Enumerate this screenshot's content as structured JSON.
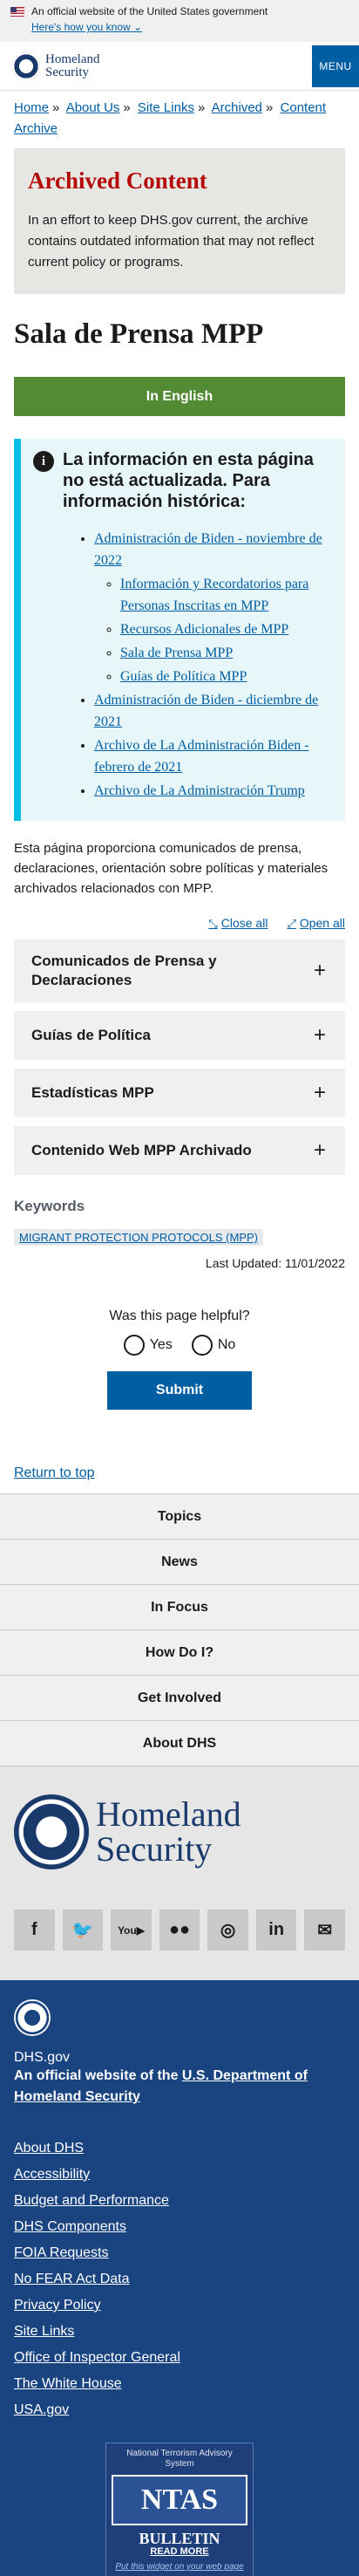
{
  "gov_banner": {
    "text": "An official website of the United States government",
    "link": "Here's how you know"
  },
  "header": {
    "logo_line1": "Homeland",
    "logo_line2": "Security",
    "menu_label": "MENU"
  },
  "breadcrumb": [
    "Home",
    "About Us",
    "Site Links",
    "Archived",
    "Content Archive"
  ],
  "archived": {
    "title": "Archived Content",
    "body": "In an effort to keep DHS.gov current, the archive contains outdated information that may not reflect current policy or programs."
  },
  "page_title": "Sala de Prensa MPP",
  "english_button": "In English",
  "alert": {
    "heading": "La información en esta página no está actualizada. Para información histórica:",
    "items": [
      {
        "label": "Administración de Biden - noviembre de 2022",
        "children": [
          "Información y Recordatorios para Personas Inscritas en MPP",
          "Recursos Adicionales de MPP",
          "Sala de Prensa MPP",
          "Guías de Política MPP"
        ]
      },
      {
        "label": "Administración de Biden - diciembre de 2021"
      },
      {
        "label": "Archivo de La Administración Biden - febrero de 2021"
      },
      {
        "label": "Archivo de La Administración Trump"
      }
    ]
  },
  "intro": "Esta página proporciona comunicados de prensa, declaraciones, orientación sobre políticas y materiales archivados relacionados con MPP.",
  "toggles": {
    "close_all": "Close all",
    "open_all": "Open all"
  },
  "accordion": [
    "Comunicados de Prensa y Declaraciones",
    "Guías de Política",
    "Estadísticas MPP",
    "Contenido Web MPP Archivado"
  ],
  "keywords": {
    "title": "Keywords",
    "tag": "MIGRANT PROTECTION PROTOCOLS (MPP)"
  },
  "last_updated": "Last Updated: 11/01/2022",
  "helpful": {
    "question": "Was this page helpful?",
    "yes": "Yes",
    "no": "No",
    "submit": "Submit"
  },
  "return_to_top": "Return to top",
  "footer_nav": [
    "Topics",
    "News",
    "In Focus",
    "How Do I?",
    "Get Involved",
    "About DHS"
  ],
  "footer_logo": {
    "line1": "Homeland",
    "line2": "Security"
  },
  "socials": [
    "facebook-icon",
    "twitter-icon",
    "youtube-icon",
    "flickr-icon",
    "instagram-icon",
    "linkedin-icon",
    "email-icon"
  ],
  "dark_footer": {
    "site": "DHS.gov",
    "official_prefix": "An official website of the ",
    "official_link": "U.S. Department of Homeland Security",
    "links": [
      "About DHS",
      "Accessibility",
      "Budget and Performance",
      "DHS Components",
      "FOIA Requests",
      "No FEAR Act Data",
      "Privacy Policy",
      "Site Links",
      "Office of Inspector General",
      "The White House",
      "USA.gov"
    ],
    "ntas": {
      "title": "National Terrorism Advisory System",
      "badge": "NTAS",
      "bulletin": "BULLETIN",
      "read_more": "READ MORE",
      "widget": "Put this widget on your web page"
    }
  }
}
